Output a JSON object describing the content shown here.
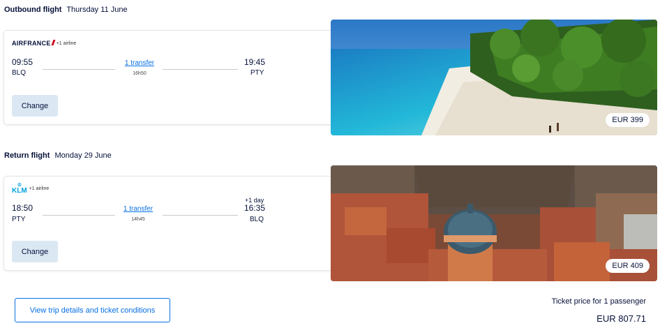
{
  "outbound": {
    "label": "Outbound flight",
    "date": "Thursday 11 June",
    "airline_name": "AIRFRANCE",
    "extra_airline": "+1 airline",
    "dep_time": "09:55",
    "dep_code": "BLQ",
    "arr_time": "19:45",
    "arr_code": "PTY",
    "transfer": "1 transfer",
    "duration": "16h50",
    "change_label": "Change",
    "price": "EUR 399"
  },
  "return": {
    "label": "Return flight",
    "date": "Monday 29 June",
    "airline_name": "KLM",
    "extra_airline": "+1 airline",
    "dep_time": "18:50",
    "dep_code": "PTY",
    "arr_time": "16:35",
    "arr_code": "BLQ",
    "next_day": "+1 day",
    "transfer": "1 transfer",
    "duration": "14h45",
    "change_label": "Change",
    "price": "EUR 409"
  },
  "footer": {
    "details_button": "View trip details and ticket conditions",
    "ticket_label": "Ticket price for 1 passenger",
    "ticket_total": "EUR 807.71"
  },
  "icons": {
    "airfrance": "airfrance-logo",
    "klm": "klm-logo"
  }
}
